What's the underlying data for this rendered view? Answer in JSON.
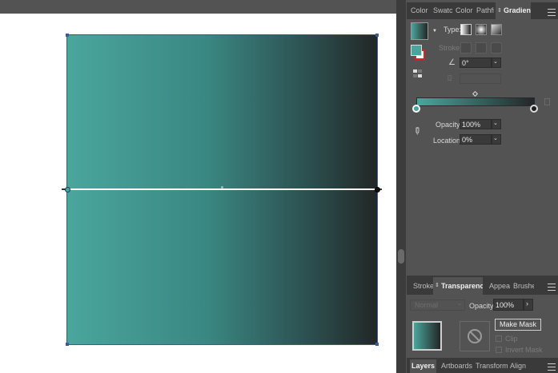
{
  "gradient_panel": {
    "tabs": [
      "Color",
      "Swatc",
      "Color",
      "Pathfi",
      "Gradient"
    ],
    "type_label": "Type:",
    "stroke_label": "Stroke:",
    "angle_value": "0°",
    "opacity_label": "Opacity:",
    "opacity_value": "100%",
    "location_label": "Location:",
    "location_value": "0%",
    "colors": {
      "start": "#4aa69d",
      "end": "#232626"
    }
  },
  "transparency_panel": {
    "tabs": [
      "Stroke",
      "Transparency",
      "Appea",
      "Brushe"
    ],
    "blend_mode": "Normal",
    "opacity_label": "Opacity:",
    "opacity_value": "100%",
    "make_mask_label": "Make Mask",
    "clip_label": "Clip",
    "invert_mask_label": "Invert Mask"
  },
  "bottom_tabs": [
    "Layers",
    "Artboards",
    "Transform",
    "Align"
  ],
  "icons": {
    "panel_menu": "hamburger-icon",
    "eyedropper": "eyedropper-icon",
    "delete_stop": "trash-icon",
    "no_mask": "prohibited-icon"
  }
}
